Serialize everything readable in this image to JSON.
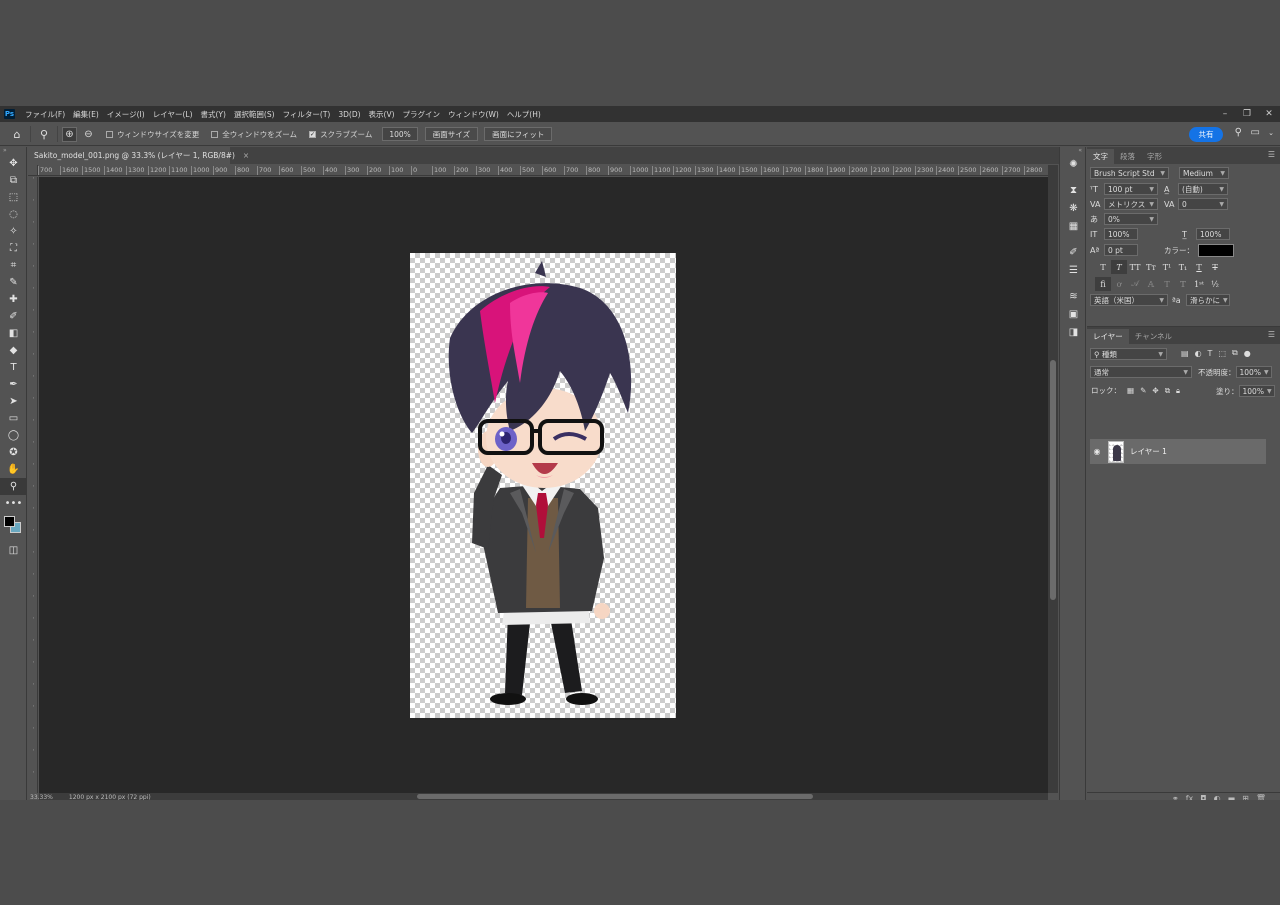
{
  "menu": {
    "logo": "Ps",
    "items": [
      "ファイル(F)",
      "編集(E)",
      "イメージ(I)",
      "レイヤー(L)",
      "書式(Y)",
      "選択範囲(S)",
      "フィルター(T)",
      "3D(D)",
      "表示(V)",
      "プラグイン",
      "ウィンドウ(W)",
      "ヘルプ(H)"
    ],
    "window_controls": [
      "–",
      "❐",
      "✕"
    ]
  },
  "options": {
    "chk_resize": "ウィンドウサイズを変更",
    "chk_all_windows": "全ウィンドウをズーム",
    "chk_scrubby": "スクラブズーム",
    "zoom_value": "100%",
    "btn_fit_screen": "画面サイズ",
    "btn_fill_screen": "画面にフィット",
    "share_label": "共有"
  },
  "document": {
    "tab_title": "Sakito_model_001.png @ 33.3% (レイヤー 1, RGB/8#)",
    "close": "×",
    "status_zoom": "33.33%",
    "status_info": "1200 px x 2100 px (72 ppi)"
  },
  "ruler_h": [
    "700",
    "1600",
    "1500",
    "1400",
    "1300",
    "1200",
    "1100",
    "1000",
    "900",
    "800",
    "700",
    "600",
    "500",
    "400",
    "300",
    "200",
    "100",
    "0",
    "100",
    "200",
    "300",
    "400",
    "500",
    "600",
    "700",
    "800",
    "900",
    "1000",
    "1100",
    "1200",
    "1300",
    "1400",
    "1500",
    "1600",
    "1700",
    "1800",
    "1900",
    "2000",
    "2100",
    "2200",
    "2300",
    "2400",
    "2500",
    "2600",
    "2700",
    "2800"
  ],
  "character": {
    "tabs": [
      "文字",
      "段落",
      "字形"
    ],
    "font_family": "Brush Script Std",
    "font_style": "Medium",
    "font_size": "100 pt",
    "leading": "(自動)",
    "kerning": "メトリクス",
    "tracking": "0",
    "tsume": "0%",
    "vscale": "100%",
    "hscale": "100%",
    "baseline": "0 pt",
    "color_label": "カラー：",
    "text_color": "#000000",
    "language": "英語（米国）",
    "antialias": "滑らかに"
  },
  "layers": {
    "tabs": [
      "レイヤー",
      "チャンネル"
    ],
    "filter": "種類",
    "blend_mode": "通常",
    "opacity_label": "不透明度：",
    "opacity": "100%",
    "lock_label": "ロック：",
    "fill_label": "塗り：",
    "fill": "100%",
    "items": [
      {
        "name": "レイヤー 1",
        "visible": true
      }
    ]
  }
}
